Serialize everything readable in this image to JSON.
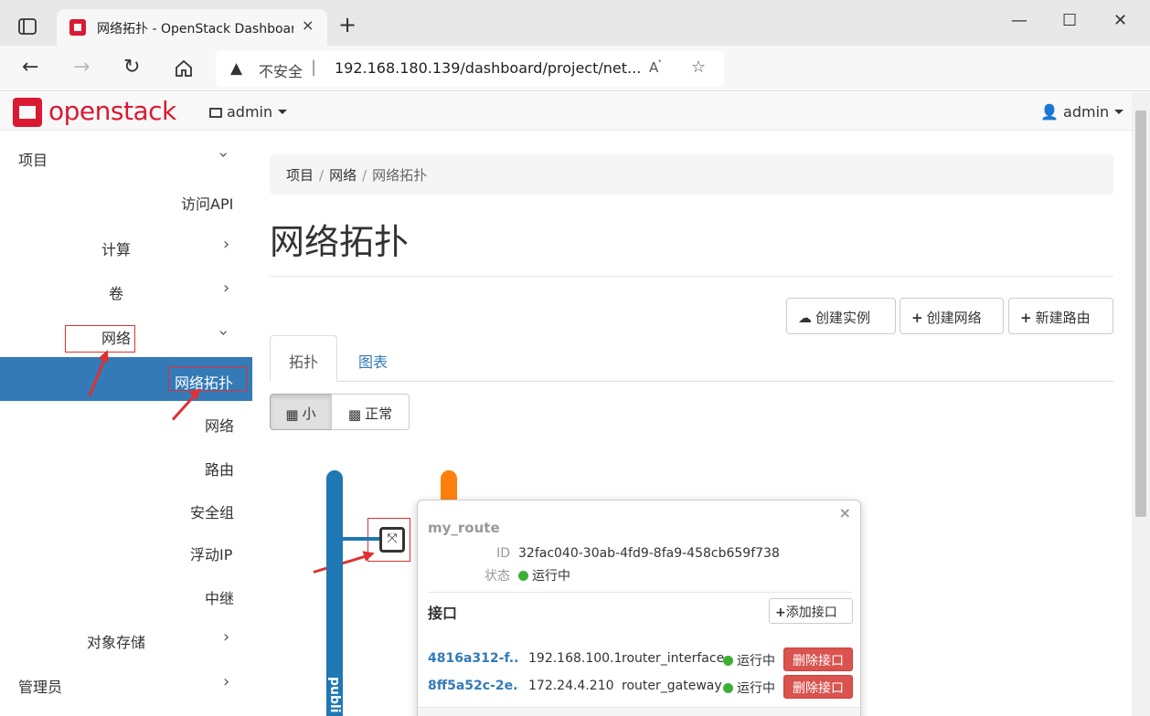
{
  "browser": {
    "tab_title": "网络拓扑 - OpenStack Dashboard",
    "tab_close": "×",
    "new_tab": "+",
    "insecure_label": "不安全",
    "url": "192.168.180.139/dashboard/project/net...",
    "window_controls": {
      "minimize": "—",
      "maximize": "☐",
      "close": "✕"
    }
  },
  "header": {
    "logo_text": "openstack",
    "project_selector": "admin",
    "user_menu": "admin"
  },
  "sidebar": {
    "project": "项目",
    "api_access": "访问API",
    "compute": "计算",
    "volumes": "卷",
    "network": "网络",
    "network_topology": "网络拓扑",
    "networks": "网络",
    "routers": "路由",
    "security_groups": "安全组",
    "floating_ips": "浮动IP",
    "trunks": "中继",
    "object_store": "对象存储",
    "admin": "管理员"
  },
  "breadcrumb": [
    "项目",
    "网络",
    "网络拓扑"
  ],
  "page_title": "网络拓扑",
  "actions": {
    "launch_instance": "创建实例",
    "create_network": "创建网络",
    "create_router": "新建路由"
  },
  "tabs": {
    "topology": "拓扑",
    "graph": "图表"
  },
  "size_toggle": {
    "small": "小",
    "normal": "正常"
  },
  "topology": {
    "network_label": "publi"
  },
  "router_popup": {
    "name": "my_route",
    "id_label": "ID",
    "id_value": "32fac040-30ab-4fd9-8fa9-458cb659f738",
    "status_label": "状态",
    "status_value": "运行中",
    "interfaces_title": "接口",
    "add_interface": "添加接口",
    "interfaces": [
      {
        "id": "4816a312-f...",
        "ip": "192.168.100.1",
        "type": "router_interface",
        "status": "运行中",
        "delete": "删除接口"
      },
      {
        "id": "8ff5a52c-2e...",
        "ip": "172.24.4.210",
        "type": "router_gateway",
        "status": "运行中",
        "delete": "删除接口"
      }
    ]
  },
  "colors": {
    "accent": "#337ab7",
    "brand": "#da1a32",
    "danger": "#d9534f",
    "public_net": "#1f77b4",
    "private_net": "#ff7f0e",
    "status_ok": "#3cb034"
  }
}
